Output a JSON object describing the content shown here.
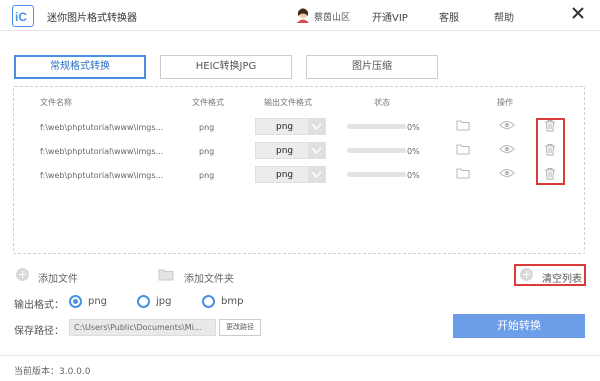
{
  "app": {
    "title": "迷你图片格式转换器",
    "logo_text": "iC",
    "username": "蔡茵山区",
    "nav": {
      "vip": "开通VIP",
      "service": "客服",
      "help": "帮助"
    }
  },
  "tabs": [
    {
      "label": "常规格式转换",
      "active": true
    },
    {
      "label": "HEIC转换JPG",
      "active": false
    },
    {
      "label": "图片压缩",
      "active": false
    }
  ],
  "table": {
    "headers": {
      "name": "文件名称",
      "format": "文件格式",
      "output": "输出文件格式",
      "status": "状态",
      "actions": "操作"
    },
    "rows": [
      {
        "name": "f:\\web\\phptutorial\\www\\imgs...",
        "format": "png",
        "output": "png",
        "progress": 0,
        "pct": "0%"
      },
      {
        "name": "f:\\web\\phptutorial\\www\\imgs...",
        "format": "png",
        "output": "png",
        "progress": 0,
        "pct": "0%"
      },
      {
        "name": "f:\\web\\phptutorial\\www\\imgs...",
        "format": "png",
        "output": "png",
        "progress": 0,
        "pct": "0%"
      }
    ]
  },
  "actions": {
    "add_file": "添加文件",
    "add_folder": "添加文件夹",
    "clear_list": "清空列表"
  },
  "output": {
    "label": "输出格式：",
    "options": [
      "png",
      "jpg",
      "bmp"
    ],
    "selected": "png"
  },
  "save": {
    "label": "保存路径：",
    "path": "C:\\Users\\Public\\Documents\\Mi...",
    "change_label": "更改路径"
  },
  "start_label": "开始转换",
  "version": "当前版本：3.0.0.0",
  "colors": {
    "accent": "#4a90e2",
    "highlight": "#d93b3b",
    "start_button": "#6b9de8"
  }
}
